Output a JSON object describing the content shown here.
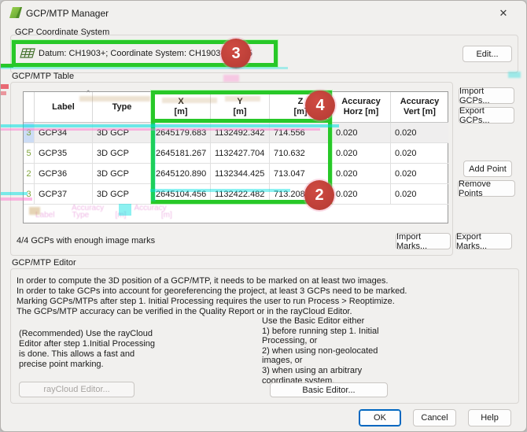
{
  "window": {
    "title": "GCP/MTP Manager"
  },
  "coordinate_system": {
    "group_label": "GCP Coordinate System",
    "datum_text": "Datum: CH1903+; Coordinate System: CH1903+ / LV95",
    "edit_button": "Edit..."
  },
  "table_section": {
    "group_label": "GCP/MTP Table",
    "status_text": "4/4 GCPs with enough image marks",
    "import_gcps_button": "Import GCPs...",
    "export_gcps_button": "Export GCPs...",
    "add_point_button": "Add Point",
    "remove_points_button": "Remove Points",
    "import_marks_button": "Import Marks...",
    "export_marks_button": "Export Marks...",
    "table": {
      "headers": {
        "label": "Label",
        "type": "Type",
        "x": "X\n[m]",
        "y": "Y\n[m]",
        "z": "Z\n[m]",
        "acc_horz": "Accuracy\nHorz [m]",
        "acc_vert": "Accuracy\nVert [m]"
      },
      "rows": [
        {
          "marks": "3",
          "label": "GCP34",
          "type": "3D GCP",
          "x": "2645179.683",
          "y": "1132492.342",
          "z": "714.556",
          "acc_horz": "0.020",
          "acc_vert": "0.020"
        },
        {
          "marks": "5",
          "label": "GCP35",
          "type": "3D GCP",
          "x": "2645181.267",
          "y": "1132427.704",
          "z": "710.632",
          "acc_horz": "0.020",
          "acc_vert": "0.020"
        },
        {
          "marks": "2",
          "label": "GCP36",
          "type": "3D GCP",
          "x": "2645120.890",
          "y": "1132344.425",
          "z": "713.047",
          "acc_horz": "0.020",
          "acc_vert": "0.020"
        },
        {
          "marks": "3",
          "label": "GCP37",
          "type": "3D GCP",
          "x": "2645104.456",
          "y": "1132422.482",
          "z": "713.208",
          "acc_horz": "0.020",
          "acc_vert": "0.020"
        }
      ]
    }
  },
  "editor_section": {
    "group_label": "GCP/MTP Editor",
    "info_lines": [
      "In order to compute the 3D position of a GCP/MTP, it needs to be marked on at least two images.",
      "In order to take GCPs into account for georeferencing the project, at least 3 GCPs need to be marked.",
      "Marking GCPs/MTPs after step 1. Initial Processing requires the user to run Process > Reoptimize.",
      "The GCPs/MTP accuracy can be verified in the Quality Report or in the rayCloud Editor."
    ],
    "raycloud_note": "(Recommended) Use the rayCloud Editor after step 1.Initial Processing is done. This allows a fast and precise point marking.",
    "basic_note": "Use the Basic Editor either\n1) before running step 1. Initial\nProcessing, or\n2) when using non-geolocated\nimages, or\n3) when using an arbitrary\ncoordinate system.",
    "raycloud_button": "rayCloud Editor...",
    "basic_button": "Basic Editor..."
  },
  "footer": {
    "ok_button": "OK",
    "cancel_button": "Cancel",
    "help_button": "Help"
  },
  "annotations": {
    "green_color": "#28c828",
    "red_color": "#b43a33",
    "circle_datum": "3",
    "circle_header": "4",
    "circle_values": "2",
    "ghost_line1": "Accuracy              Accuracy",
    "ghost_line2": "Label        Type            [m]                [m]"
  }
}
